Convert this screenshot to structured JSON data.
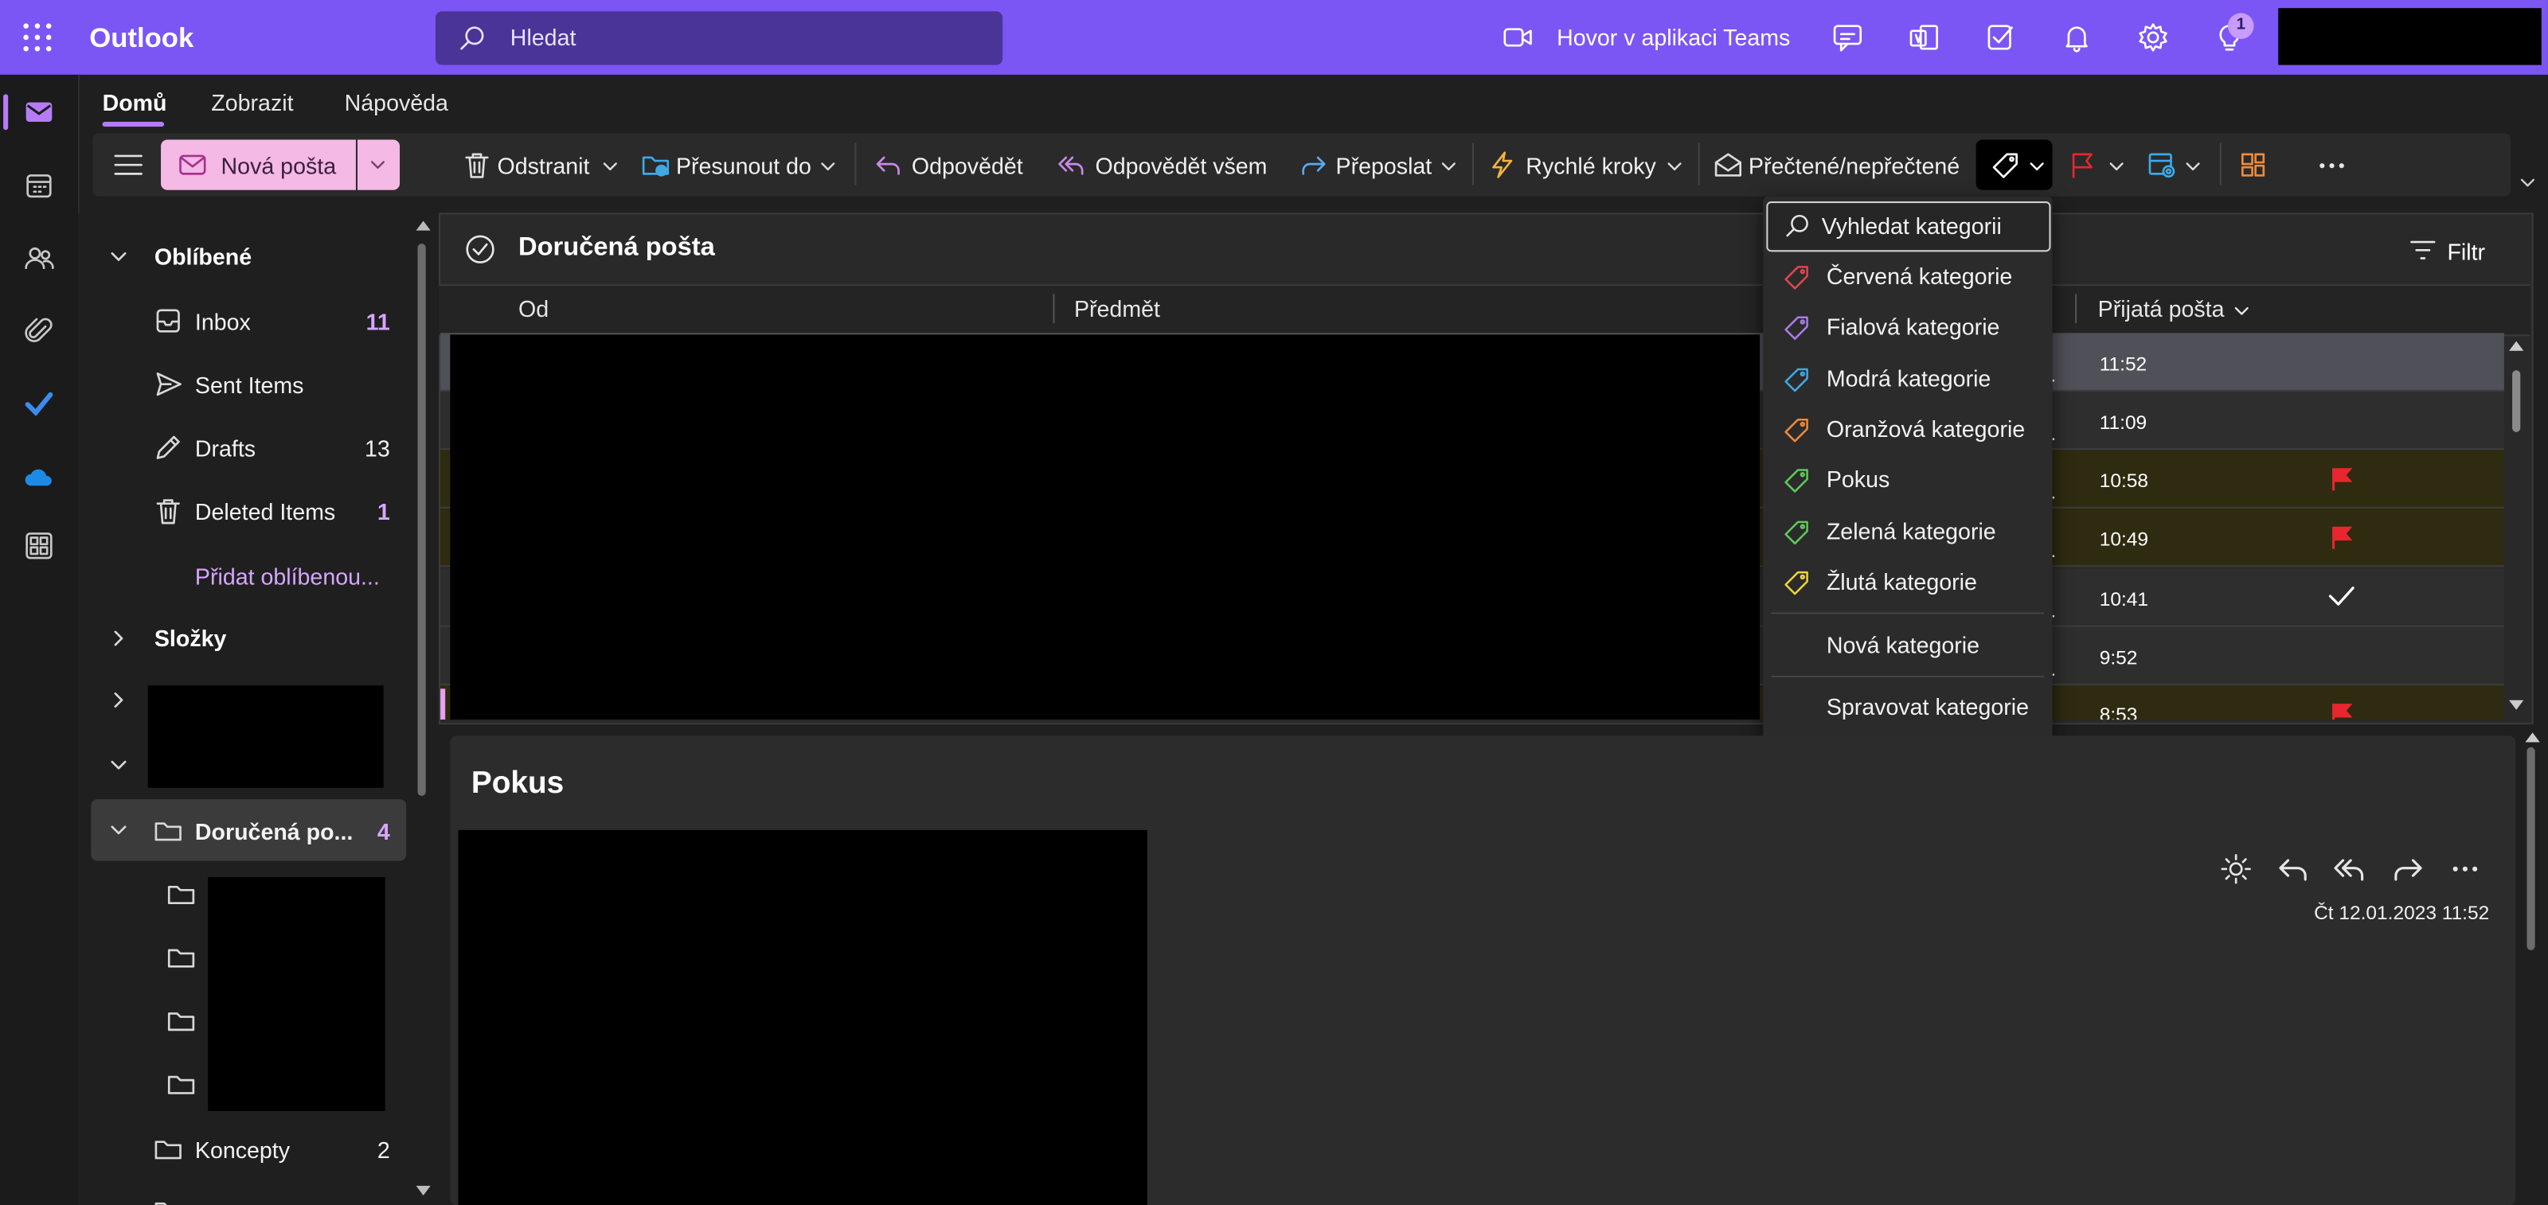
{
  "app": {
    "title": "Outlook"
  },
  "search": {
    "placeholder": "Hledat"
  },
  "topbar": {
    "teams_label": "Hovor v aplikaci Teams",
    "notification_badge": "1"
  },
  "ribbon_tabs": [
    "Domů",
    "Zobrazit",
    "Nápověda"
  ],
  "toolbar": {
    "new_mail": "Nová pošta",
    "delete": "Odstranit",
    "move_to": "Přesunout do",
    "reply": "Odpovědět",
    "reply_all": "Odpovědět všem",
    "forward": "Přeposlat",
    "quick_steps": "Rychlé kroky",
    "read_unread": "Přečtené/nepřečtené"
  },
  "folders": {
    "favorites_header": "Oblíbené",
    "favorites": [
      {
        "label": "Inbox",
        "count": "11",
        "icon": "inbox-icon"
      },
      {
        "label": "Sent Items",
        "count": "",
        "icon": "send-icon"
      },
      {
        "label": "Drafts",
        "count": "13",
        "icon": "pencil-icon"
      },
      {
        "label": "Deleted Items",
        "count": "1",
        "icon": "trash-icon"
      }
    ],
    "add_favorite": "Přidat oblíbenou...",
    "folders_header": "Složky",
    "selected_folder": {
      "label": "Doručená po...",
      "count": "4"
    },
    "drafts_folder": {
      "label": "Koncepty",
      "count": "2"
    }
  },
  "mail_list": {
    "title": "Doručená pošta",
    "filter": "Filtr",
    "columns": {
      "from": "Od",
      "subject": "Předmět",
      "received": "Přijatá pošta"
    },
    "rows": [
      {
        "time": "11:52",
        "flag": "",
        "state": "selected"
      },
      {
        "time": "11:09",
        "flag": "",
        "state": "normal"
      },
      {
        "time": "10:58",
        "flag": "flag",
        "state": "flagged"
      },
      {
        "time": "10:49",
        "flag": "flag",
        "state": "flagged"
      },
      {
        "time": "10:41",
        "flag": "check",
        "state": "normal"
      },
      {
        "time": "9:52",
        "flag": "",
        "state": "normal"
      },
      {
        "time": "8:53",
        "flag": "flag",
        "state": "flagged"
      }
    ]
  },
  "category_menu": {
    "search_placeholder": "Vyhledat kategorii",
    "items": [
      {
        "label": "Červená kategorie",
        "color": "#e0474e"
      },
      {
        "label": "Fialová kategorie",
        "color": "#a97ce8"
      },
      {
        "label": "Modrá kategorie",
        "color": "#3fa9e6"
      },
      {
        "label": "Oranžová kategorie",
        "color": "#f08a3a"
      },
      {
        "label": "Pokus",
        "color": "#5fca5a"
      },
      {
        "label": "Zelená kategorie",
        "color": "#5fca5a"
      },
      {
        "label": "Žlutá kategorie",
        "color": "#f0d43a"
      }
    ],
    "new_category": "Nová kategorie",
    "manage_categories": "Spravovat kategorie"
  },
  "reading_pane": {
    "subject": "Pokus",
    "date": "Čt 12.01.2023 11:52"
  },
  "colors": {
    "brand": "#7b56f5",
    "accent": "#b67cf8",
    "flag": "#e8262f",
    "new_mail_bg": "#f4b9e5"
  }
}
